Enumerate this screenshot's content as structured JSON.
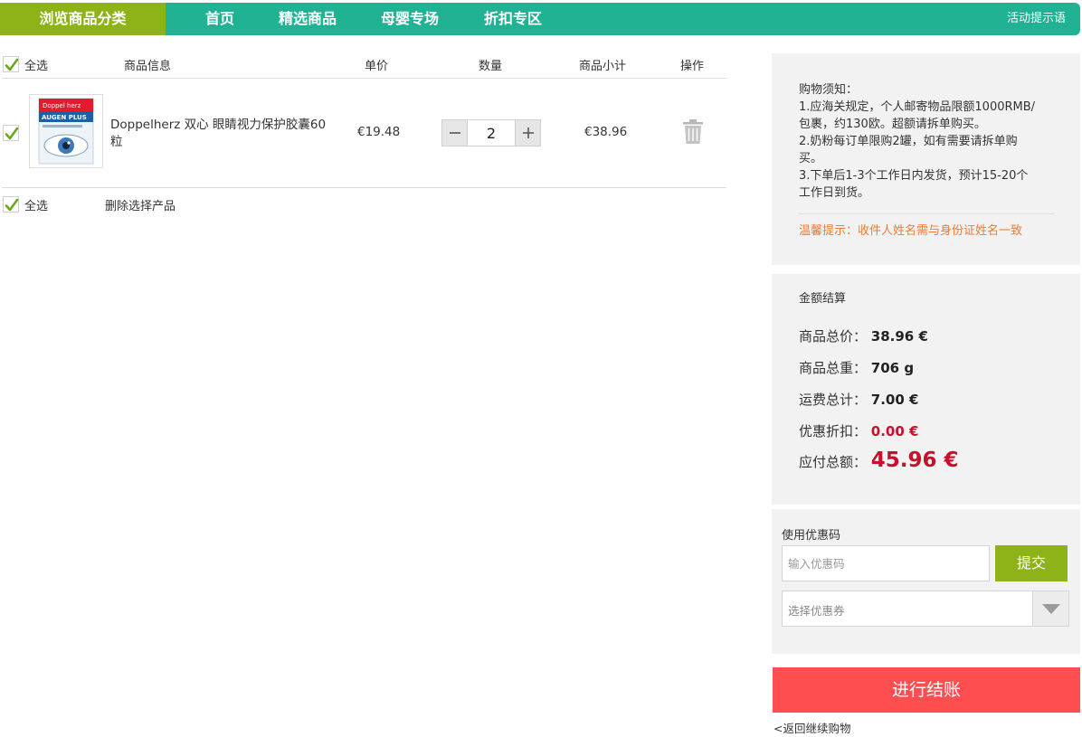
{
  "nav": {
    "category": "浏览商品分类",
    "items": [
      "首页",
      "精选商品",
      "母婴专场",
      "折扣专区"
    ],
    "tip": "活动提示语"
  },
  "cart": {
    "select_all": "全选",
    "headers": {
      "info": "商品信息",
      "unit_price": "单价",
      "quantity": "数量",
      "subtotal": "商品小计",
      "action": "操作"
    },
    "items": [
      {
        "name": "Doppelherz 双心 眼睛视力保护胶囊60粒",
        "unit_price": "€19.48",
        "quantity": "2",
        "subtotal": "€38.96",
        "image_text": [
          "Doppel herz",
          "AUGEN PLUS"
        ]
      }
    ],
    "footer_select_all": "全选",
    "delete_selected": "删除选择产品"
  },
  "notice": {
    "title": "购物须知：",
    "lines": [
      "1.应海关规定，个人邮寄物品限额1000RMB/",
      "包裹，约130欧。超额请拆单购买。",
      "2.奶粉每订单限购2罐，如有需要请拆单购",
      "买。",
      "3.下单后1-3个工作日内发货，预计15-20个",
      "工作日到货。"
    ],
    "warning": "温馨提示：收件人姓名需与身份证姓名一致"
  },
  "summary": {
    "title": "金额结算",
    "rows": [
      {
        "label": "商品总价：",
        "value": "38.96 €"
      },
      {
        "label": "商品总重：",
        "value": "706 g"
      },
      {
        "label": "运费总计：",
        "value": "7.00 €"
      },
      {
        "label": "优惠折扣：",
        "value": "0.00 €"
      },
      {
        "label": "应付总额：",
        "value": "45.96 €"
      }
    ]
  },
  "coupon": {
    "label": "使用优惠码",
    "input_placeholder": "输入优惠码",
    "input_value": "",
    "submit": "提交",
    "select_placeholder": "选择优惠券"
  },
  "checkout": {
    "button": "进行结账",
    "back": "<返回继续购物"
  },
  "colors": {
    "nav_bg": "#21b193",
    "category_bg": "#8db318",
    "accent_red": "#c8102e",
    "checkout_bg": "#ff4e50",
    "warning": "#f07a32"
  }
}
